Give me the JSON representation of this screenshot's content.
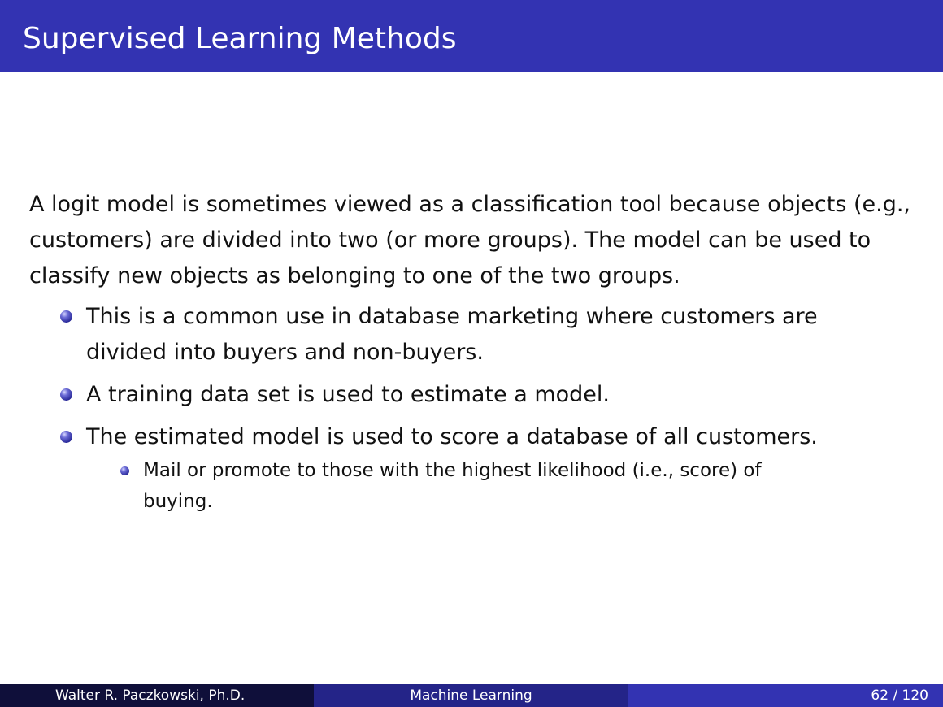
{
  "header": {
    "title": "Supervised Learning Methods"
  },
  "body": {
    "intro": "A logit model is sometimes viewed as a classification tool because objects (e.g., customers) are divided into two (or more groups). The model can be used to classify new objects as belonging to one of the two groups.",
    "bullets": [
      {
        "text": "This is a common use in database marketing where customers are divided into buyers and non-buyers."
      },
      {
        "text": "A training data set is used to estimate a model."
      },
      {
        "text": "The estimated model is used to score a database of all customers.",
        "subbullets": [
          {
            "text": "Mail or promote to those with the highest likelihood (i.e., score) of buying."
          }
        ]
      }
    ]
  },
  "footer": {
    "author": "Walter R. Paczkowski, Ph.D.",
    "topic": "Machine Learning",
    "page": "62 / 120"
  },
  "colors": {
    "header_bar": "#3333b2",
    "footer_author": "#0f0f3a",
    "footer_topic": "#242488",
    "footer_page": "#3333b2",
    "bullet": "#2a2a9a"
  }
}
